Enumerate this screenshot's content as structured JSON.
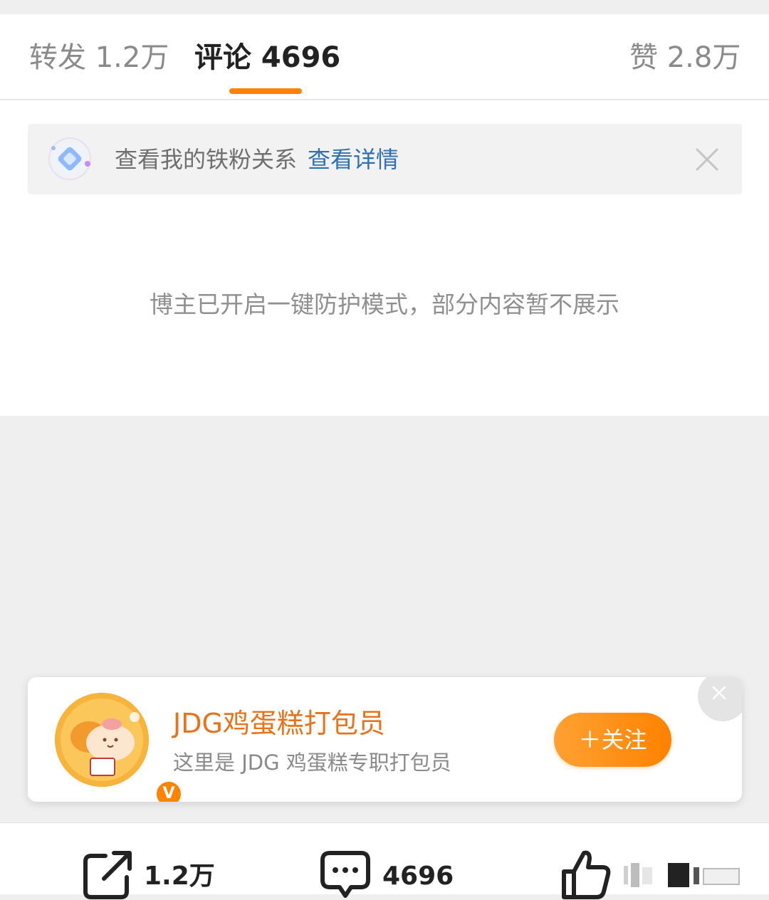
{
  "tabs": {
    "repost": "转发 1.2万",
    "comment": "评论 4696",
    "like": "赞 2.8万"
  },
  "banner": {
    "text": "查看我的铁粉关系",
    "link": "查看详情"
  },
  "notice": "博主已开启一键防护模式，部分内容暂不展示",
  "card": {
    "name": "JDG鸡蛋糕打包员",
    "desc": "这里是 JDG 鸡蛋糕专职打包员",
    "follow": "＋关注",
    "badge": "V"
  },
  "bottom": {
    "repost_count": "1.2万",
    "comment_count": "4696"
  },
  "colors": {
    "accent": "#ff8200",
    "link": "#2f6fb3"
  }
}
